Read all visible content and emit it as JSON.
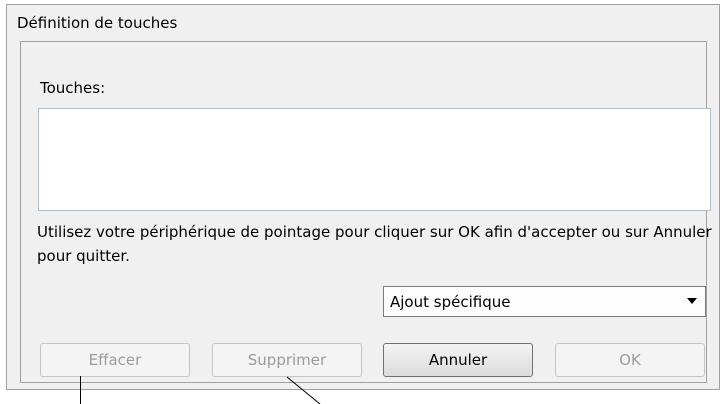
{
  "window": {
    "title": "Définition de touches"
  },
  "keys": {
    "label": "Touches:",
    "value": ""
  },
  "instructions": "Utilisez votre périphérique de pointage pour cliquer sur OK afin d'accepter ou sur Annuler pour quitter.",
  "dropdown": {
    "selected": "Ajout spécifique"
  },
  "buttons": {
    "clear": "Effacer",
    "delete": "Supprimer",
    "cancel": "Annuler",
    "ok": "OK"
  }
}
